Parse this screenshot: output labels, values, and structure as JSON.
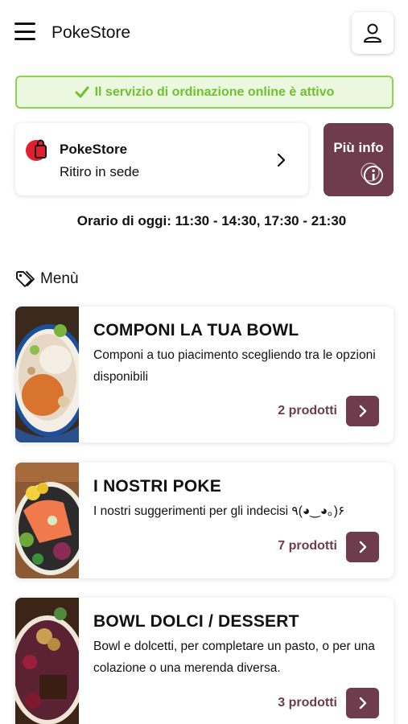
{
  "header": {
    "title": "PokeStore",
    "menu_icon": "hamburger-menu-icon",
    "user_icon": "user-account-icon"
  },
  "banner": {
    "text": "Il servizio di ordinazione online è attivo",
    "icon": "check-icon",
    "color": "#6ec12f"
  },
  "store": {
    "name": "PokeStore",
    "mode": "Ritiro in sede",
    "logo_icon": "shopping-bag-logo-icon"
  },
  "info_button": {
    "label": "Più info",
    "icon": "info-circle-icon"
  },
  "hours": "Orario di oggi: 11:30 - 14:30, 17:30 - 21:30",
  "menu_section": {
    "label": "Menù",
    "icon": "tag-icon"
  },
  "categories": [
    {
      "title": "COMPONI LA TUA BOWL",
      "desc": "Componi a tuo piacimento scegliendo tra le opzioni disponibili",
      "count": "2 prodotti"
    },
    {
      "title": "I NOSTRI POKE",
      "desc": "I nostri suggerimenti per gli indecisi ٩(◕‿◕｡)۶",
      "count": "7 prodotti"
    },
    {
      "title": "BOWL DOLCI / DESSERT",
      "desc": "Bowl e dolcetti, per completare un pasto, o per una colazione o una merenda diversa.",
      "count": "3 prodotti"
    }
  ],
  "colors": {
    "accent": "#6e3c4c",
    "banner_border": "#8ed34f",
    "banner_bg": "#ecf7df",
    "logo_red": "#e0202e"
  }
}
